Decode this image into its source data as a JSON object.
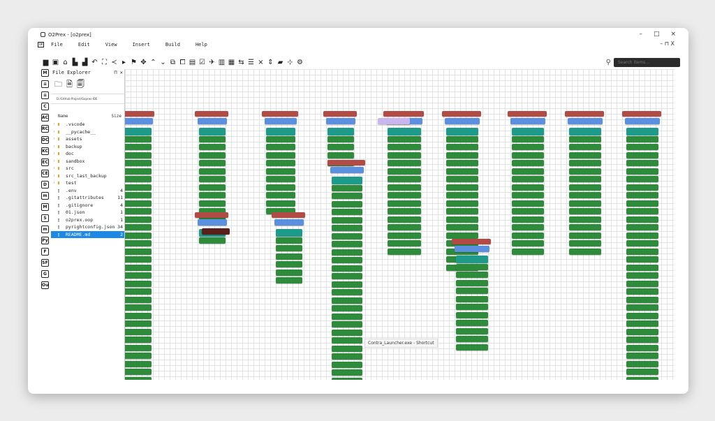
{
  "window": {
    "title": "O2Prex - [o2prex]"
  },
  "menu": [
    "File",
    "Edit",
    "View",
    "Insert",
    "Build",
    "Help"
  ],
  "menu_right": "– ⊓ X",
  "window_controls": [
    "–",
    "□",
    "×"
  ],
  "search": {
    "placeholder": "Search items..."
  },
  "toolbar_icons": [
    "folder-icon",
    "image-icon",
    "open-icon",
    "save-icon",
    "save-as-icon",
    "undo-icon",
    "fullscreen-icon",
    "share-icon",
    "pointer-icon",
    "flag-icon",
    "move-icon",
    "up-icon",
    "down-icon",
    "copy-icon",
    "paste-icon",
    "clipboard-icon",
    "check-icon",
    "run-icon",
    "left-panel-icon",
    "right-panel-icon",
    "align-icon",
    "list-icon",
    "collapse-icon",
    "expand-icon",
    "map-icon",
    "grid-icon",
    "settings-icon"
  ],
  "leftbar": [
    "M",
    "≡",
    "≡",
    "C",
    "AC",
    "RC",
    "DC",
    "KC",
    "EC",
    "CE",
    "D",
    "m",
    "M",
    "S",
    "m",
    "Py",
    "F",
    "SF",
    "G",
    "Ou"
  ],
  "explorer": {
    "title": "File Explorer",
    "path": "D:/GitHub Project/Gopras-IDE",
    "col_name": "Name",
    "col_size": "Size",
    "items": [
      {
        "name": ".vscode",
        "size": "",
        "type": "folder"
      },
      {
        "name": "__pycache__",
        "size": "",
        "type": "folder"
      },
      {
        "name": "assets",
        "size": "",
        "type": "folder"
      },
      {
        "name": "backup",
        "size": "",
        "type": "folder"
      },
      {
        "name": "doc",
        "size": "",
        "type": "folder"
      },
      {
        "name": "sandbox",
        "size": "",
        "type": "folder"
      },
      {
        "name": "src",
        "size": "",
        "type": "folder"
      },
      {
        "name": "src_last_backup",
        "size": "",
        "type": "folder"
      },
      {
        "name": "test",
        "size": "",
        "type": "folder"
      },
      {
        "name": ".env",
        "size": "4",
        "type": "file"
      },
      {
        "name": ".gitattributes",
        "size": "11",
        "type": "file"
      },
      {
        "name": ".gitignore",
        "size": "4",
        "type": "file"
      },
      {
        "name": "01.json",
        "size": "1",
        "type": "file"
      },
      {
        "name": "o2prex.oop",
        "size": "1",
        "type": "file"
      },
      {
        "name": "pyrightconfig.json",
        "size": "34",
        "type": "file"
      },
      {
        "name": "README.md",
        "size": "2",
        "type": "file"
      }
    ]
  },
  "status": {
    "shortcut_label": "Contra_Launcher.exe - Shortcut"
  },
  "colors": {
    "header": "#b24a45",
    "class": "#5b8fe0",
    "teal": "#1e9a8b",
    "method": "#2e8b3b",
    "accent": "#1e88e5"
  }
}
